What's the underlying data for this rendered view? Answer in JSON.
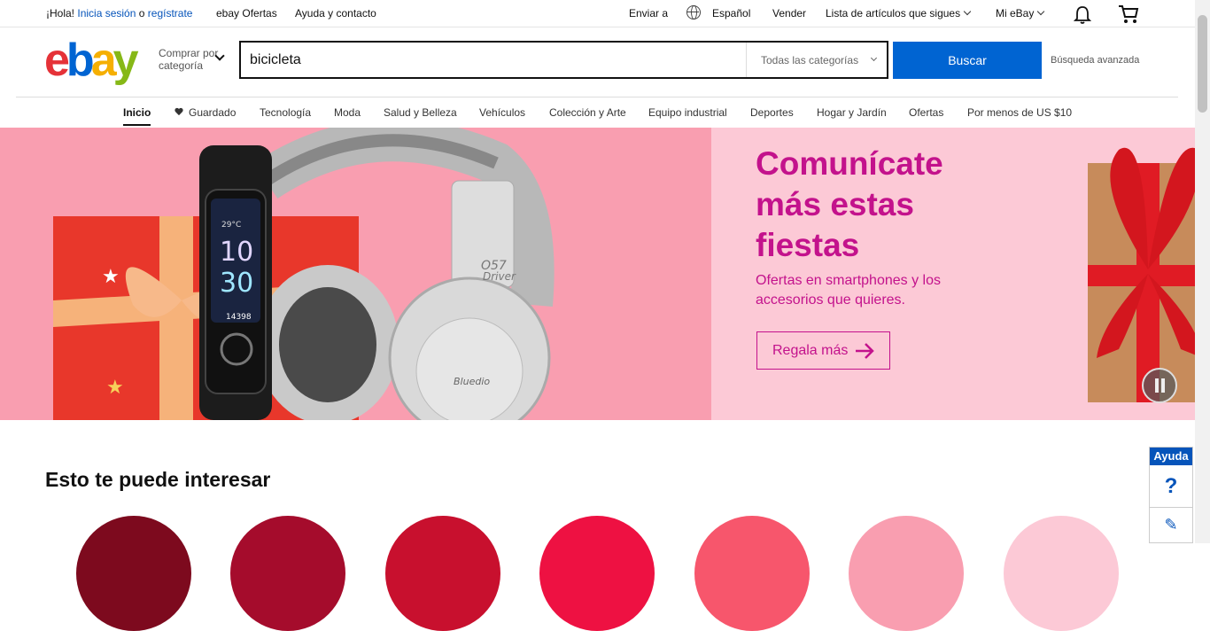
{
  "topbar": {
    "greeting": "¡Hola!",
    "signin": "Inicia sesión",
    "or": "o",
    "register": "regístrate",
    "deals": "ebay Ofertas",
    "help": "Ayuda y contacto",
    "ship_to": "Enviar a",
    "language": "Español",
    "sell": "Vender",
    "watchlist": "Lista de artículos que sigues",
    "my_ebay": "Mi eBay"
  },
  "header": {
    "logo": [
      "e",
      "b",
      "a",
      "y"
    ],
    "shop_by_category": "Comprar por categoría",
    "search_value": "bicicleta",
    "category_select": "Todas las categorías",
    "search_button": "Buscar",
    "advanced": "Búsqueda avanzada"
  },
  "nav": {
    "items": [
      "Inicio",
      "Guardado",
      "Tecnología",
      "Moda",
      "Salud y Belleza",
      "Vehículos",
      "Colección y Arte",
      "Equipo industrial",
      "Deportes",
      "Hogar y Jardín",
      "Ofertas",
      "Por menos de US $10"
    ]
  },
  "hero": {
    "title": "Comunícate más estas fiestas",
    "subtitle": "Ofertas en smartphones y los accesorios que quieres.",
    "cta": "Regala más",
    "watch_time": "10\n30",
    "watch_temp": "29°C",
    "watch_steps": "14398",
    "headphone_model": "O57 Driver",
    "headphone_brand": "Bluedio",
    "colors": {
      "left_bg": "#f99eb0",
      "right_bg": "#fcc9d6",
      "accent": "#c3128c"
    }
  },
  "section": {
    "title": "Esto te puede interesar"
  },
  "help_widget": {
    "label": "Ayuda",
    "question": "?"
  }
}
